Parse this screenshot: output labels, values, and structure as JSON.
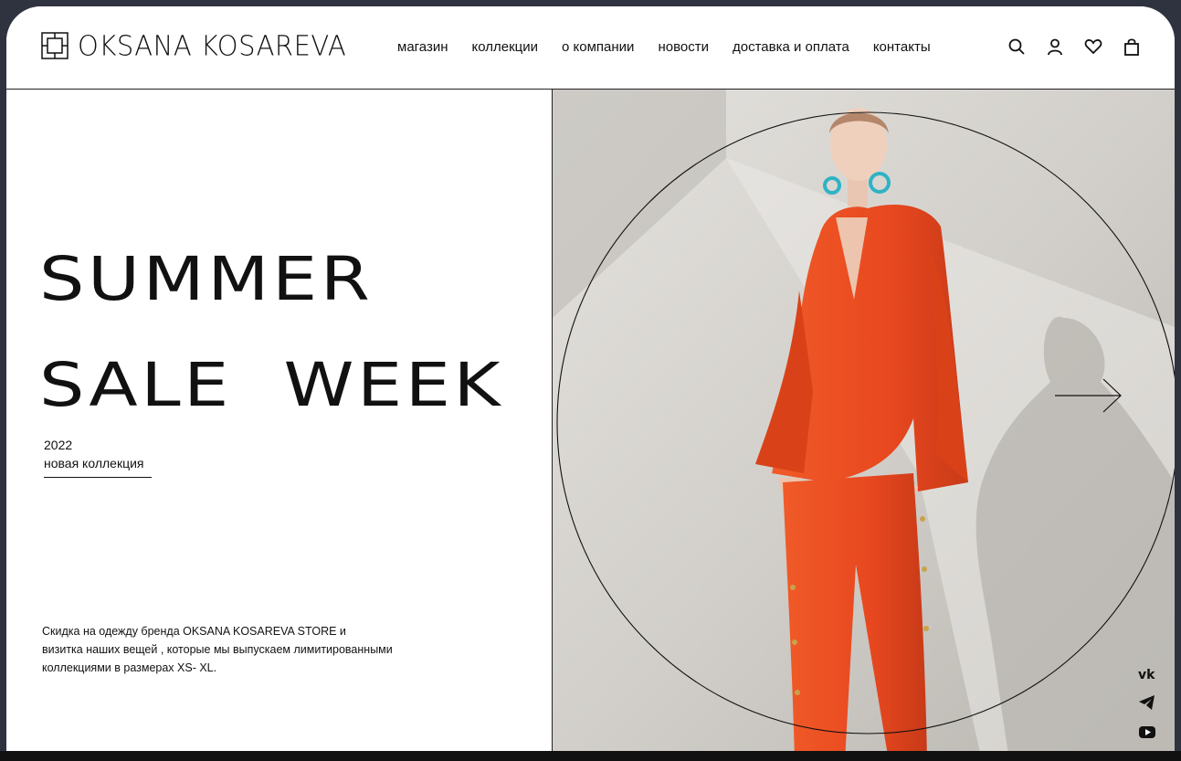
{
  "brand": {
    "name": "OKSANA KOSAREVA"
  },
  "nav": [
    "магазин",
    "коллекции",
    "о компании",
    "новости",
    "доставка и оплата",
    "контакты"
  ],
  "header_icons": [
    "search-icon",
    "user-icon",
    "heart-icon",
    "bag-icon"
  ],
  "hero": {
    "line1": "SUMMER",
    "line2": "SALE  WEEK",
    "year": "2022",
    "collection": "новая коллекция",
    "description_1": "Скидка на одежду  бренда OKSANA KOSAREVA STORE и",
    "description_2": "визитка наших вещей , которые  мы выпускаем лимитированными",
    "description_3": "коллекциями в размерах XS- XL."
  },
  "social_icons": [
    "vk-icon",
    "telegram-icon",
    "youtube-icon"
  ],
  "colors": {
    "accent": "#e8481f",
    "background": "#ffffff",
    "frame": "#2f3340"
  }
}
